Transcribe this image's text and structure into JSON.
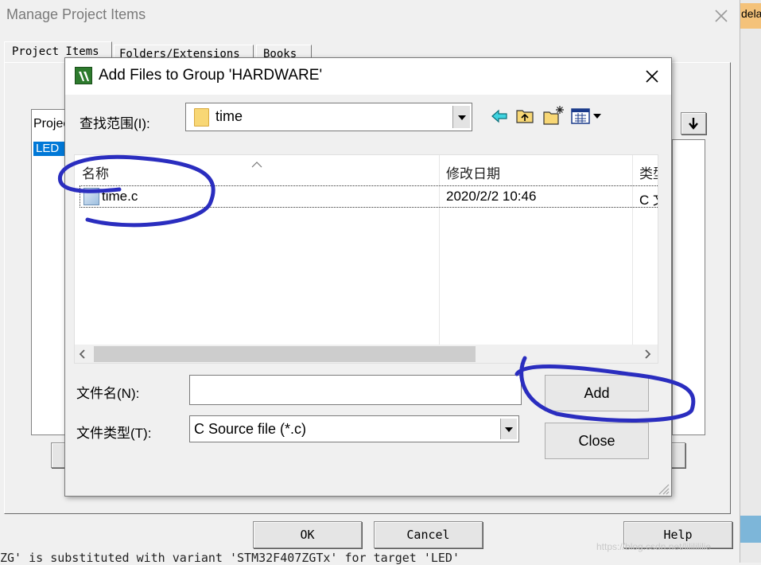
{
  "outer_window": {
    "title": "Manage Project Items",
    "right_edge_label": "dela",
    "tabs": [
      {
        "label": "Project Items"
      },
      {
        "label": "Folders/Extensions"
      },
      {
        "label": "Books"
      }
    ],
    "list_header": "Projec",
    "list_selected": "LED",
    "ok_label": "OK",
    "cancel_label": "Cancel",
    "help_label": "Help",
    "status_text": "ZG' is substituted with variant 'STM32F407ZGTx' for target 'LED'",
    "watermark": "https://blog.csdn.net/lililililie"
  },
  "dialog": {
    "title": "Add Files to Group 'HARDWARE'",
    "look_in_label": "查找范围(I):",
    "look_in_value": "time",
    "columns": [
      "名称",
      "修改日期",
      "类型"
    ],
    "files": [
      {
        "name": "time.c",
        "date": "2020/2/2 10:46",
        "type": "C 文"
      }
    ],
    "filename_label": "文件名(N):",
    "filename_value": "",
    "filetype_label": "文件类型(T):",
    "filetype_value": "C Source file (*.c)",
    "add_label": "Add",
    "close_label": "Close"
  },
  "colors": {
    "selection": "#0078d7",
    "annotation_ink": "#2a2dbf",
    "folder": "#f8d775"
  }
}
